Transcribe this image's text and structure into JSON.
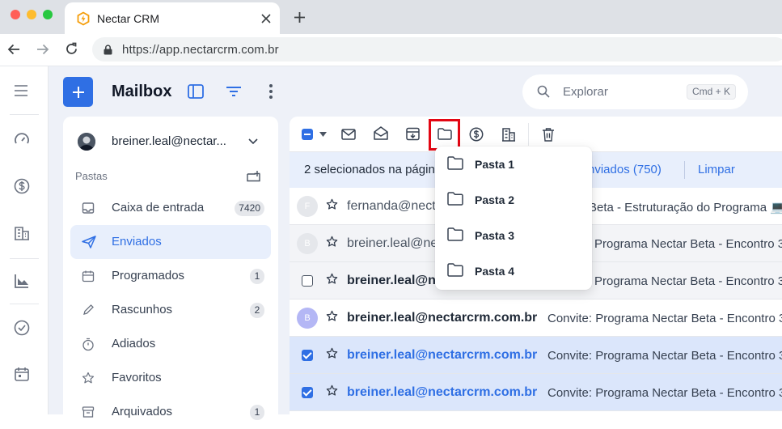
{
  "browser": {
    "tab_title": "Nectar CRM",
    "url": "https://app.nectarcrm.com.br"
  },
  "header": {
    "title": "Mailbox",
    "search_placeholder": "Explorar",
    "search_shortcut": "Cmd + K"
  },
  "account": {
    "email": "breiner.leal@nectar..."
  },
  "folders": {
    "section_label": "Pastas",
    "items": [
      {
        "label": "Caixa de entrada",
        "count": "7420",
        "icon": "inbox-icon"
      },
      {
        "label": "Enviados",
        "count": "",
        "icon": "send-icon",
        "active": true
      },
      {
        "label": "Programados",
        "count": "1",
        "icon": "calendar-icon"
      },
      {
        "label": "Rascunhos",
        "count": "2",
        "icon": "pencil-icon"
      },
      {
        "label": "Adiados",
        "count": "",
        "icon": "timer-icon"
      },
      {
        "label": "Favoritos",
        "count": "",
        "icon": "star-icon"
      },
      {
        "label": "Arquivados",
        "count": "1",
        "icon": "archive-icon"
      }
    ]
  },
  "selection_bar": {
    "text": "2 selecionados na págin",
    "select_all_link": "nviados (750)",
    "clear_link": "Limpar"
  },
  "emails": [
    {
      "avatar": "F",
      "sender": "fernanda@nect",
      "subject": "Beta - Estruturação do Programa 💻 ("
    },
    {
      "avatar": "B",
      "sender": "breiner.leal@ne",
      "subject": "Programa Nectar Beta - Encontro 3"
    },
    {
      "avatar": "",
      "sender": "breiner.leal@n",
      "subject": "Programa Nectar Beta - Encontro 3"
    },
    {
      "avatar": "B",
      "sender": "breiner.leal@nectarcrm.com.br",
      "subject": "Convite: Programa Nectar Beta - Encontro 3"
    },
    {
      "avatar": "",
      "sender": "breiner.leal@nectarcrm.com.br",
      "subject": "Convite: Programa Nectar Beta - Encontro 3"
    },
    {
      "avatar": "",
      "sender": "breiner.leal@nectarcrm.com.br",
      "subject": "Convite: Programa Nectar Beta - Encontro 3"
    }
  ],
  "move_menu": {
    "items": [
      "Pasta 1",
      "Pasta 2",
      "Pasta 3",
      "Pasta 4"
    ]
  },
  "colors": {
    "accent": "#2f6fe4",
    "highlight_box": "#e30613",
    "selected_row": "#dbe6fb"
  }
}
